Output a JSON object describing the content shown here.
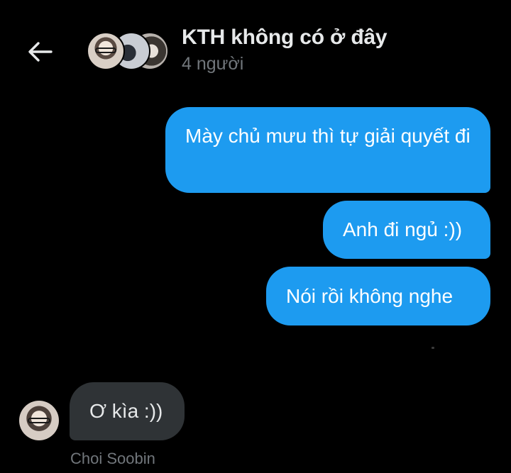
{
  "header": {
    "title": "KTH không có ở đây",
    "subtitle": "4 người"
  },
  "icons": {
    "back": "arrow-left-icon"
  },
  "colors": {
    "background": "#000000",
    "sent_bubble": "#1d9bf0",
    "received_bubble": "#2f3336",
    "secondary_text": "#71767b"
  },
  "messages": {
    "sent": [
      {
        "text": "Mày chủ mưu thì tự giải quyết đi"
      },
      {
        "text": "Anh đi ngủ :))"
      },
      {
        "text": "Nói rồi không nghe"
      }
    ],
    "received": [
      {
        "text": "Ơ kìa :))",
        "sender": "Choi Soobin"
      }
    ]
  }
}
